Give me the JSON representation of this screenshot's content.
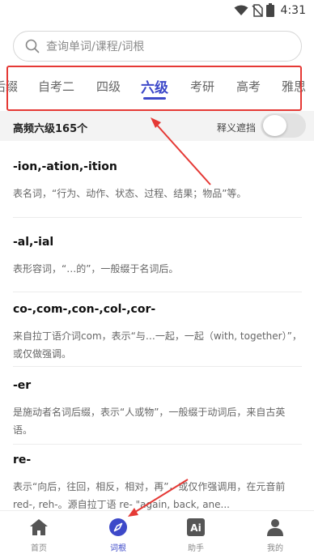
{
  "status": {
    "time": "4:31"
  },
  "search": {
    "placeholder": "查询单词/课程/词根"
  },
  "tabs": [
    "后缀",
    "自考二",
    "四级",
    "六级",
    "考研",
    "高考",
    "雅思"
  ],
  "active_tab": "六级",
  "subheader": {
    "title": "高频六级165个",
    "toggle_label": "释义遮挡",
    "toggle_on": false
  },
  "entries": [
    {
      "title": "-ion,-ation,-ition",
      "desc": "表名词，“行为、动作、状态、过程、结果；物品”等。"
    },
    {
      "title": "-al,-ial",
      "desc": "表形容词，“…的”，一般缀于名词后。"
    },
    {
      "title": "co-,com-,con-,col-,cor-",
      "desc": "来自拉丁语介词com，表示“与…一起，一起（with, together）”，或仅做强调。"
    },
    {
      "title": "-er",
      "desc": "是施动者名词后缀，表示“人或物”，一般缀于动词后，来自古英语。"
    },
    {
      "title": "re-",
      "desc": "表示“向后，往回，相反，相对，再”，或仅作强调用，在元音前 red-, reh-。源自拉丁语 re- \"again, back, ane..."
    }
  ],
  "nav": [
    {
      "label": "首页",
      "icon": "home-icon"
    },
    {
      "label": "词根",
      "icon": "compass-icon"
    },
    {
      "label": "助手",
      "icon": "ai-icon"
    },
    {
      "label": "我的",
      "icon": "person-icon"
    }
  ],
  "active_nav": "词根",
  "colors": {
    "accent": "#3d49c9",
    "annotation": "#e53935"
  }
}
